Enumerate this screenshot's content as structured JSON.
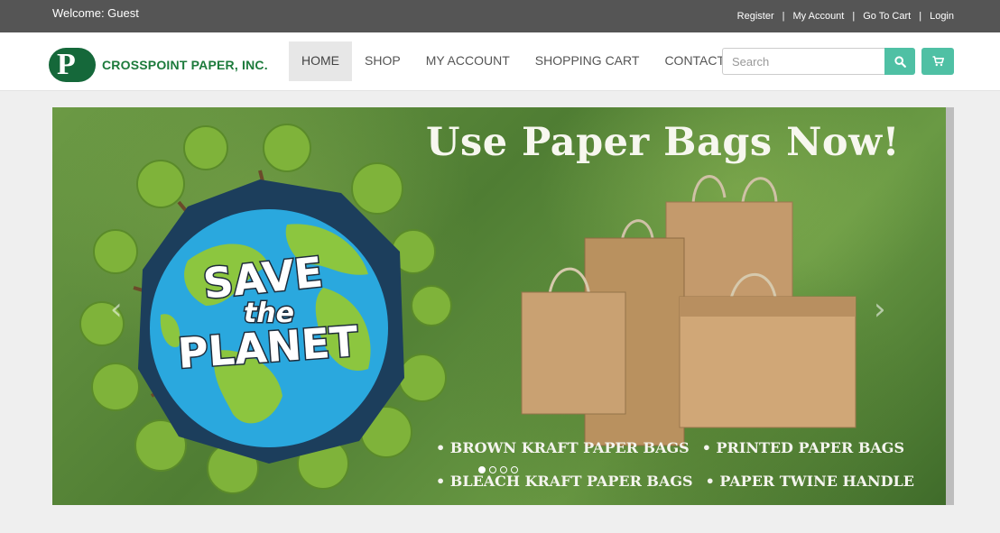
{
  "topbar": {
    "welcome": "Welcome: Guest",
    "links": [
      "Register",
      "My Account",
      "Go To Cart",
      "Login"
    ],
    "bg_color": "#555555"
  },
  "brand": {
    "name": "CROSSPOINT PAPER, INC.",
    "logo_letter": "P",
    "color": "#15683a"
  },
  "nav": {
    "items": [
      "HOME",
      "SHOP",
      "MY ACCOUNT",
      "SHOPPING CART",
      "CONTACT US"
    ],
    "active": "HOME"
  },
  "search": {
    "placeholder": "Search",
    "value": "",
    "icon": "search-icon",
    "button_color": "#4fc0a4"
  },
  "cart": {
    "icon": "cart-icon"
  },
  "banner": {
    "headline": "Use Paper Bags Now!",
    "globe_text": [
      "SAVE",
      "the",
      "PLANET"
    ],
    "bullets_row1": [
      "• BROWN KRAFT PAPER BAGS",
      "• PRINTED PAPER BAGS"
    ],
    "bullets_row2": [
      "• BLEACH KRAFT PAPER BAGS",
      "• PAPER TWINE HANDLE"
    ],
    "prev_icon": "chevron-left-icon",
    "next_icon": "chevron-right-icon",
    "slides_count": 4,
    "active_slide": 1
  }
}
